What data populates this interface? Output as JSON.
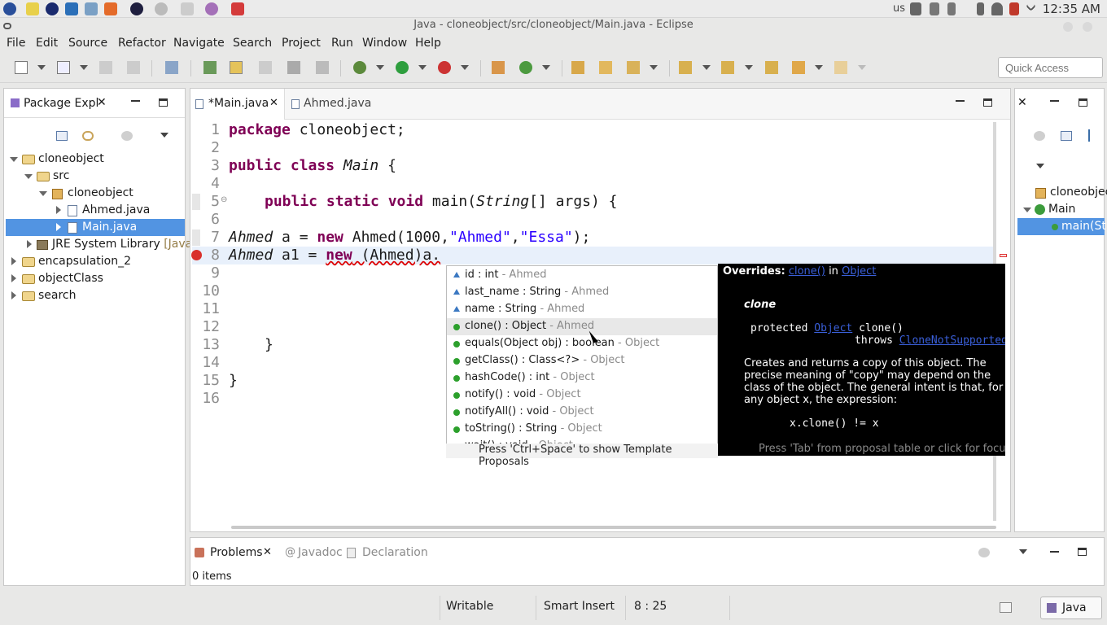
{
  "system": {
    "keyboard": "us",
    "clock": "12:35 AM"
  },
  "window": {
    "title": "Java - cloneobject/src/cloneobject/Main.java - Eclipse"
  },
  "menu": [
    "File",
    "Edit",
    "Source",
    "Refactor",
    "Navigate",
    "Search",
    "Project",
    "Run",
    "Window",
    "Help"
  ],
  "quick_access": {
    "placeholder": "Quick Access"
  },
  "package_explorer": {
    "tab": "Package Expl",
    "tree": [
      {
        "label": "cloneobject",
        "level": 0
      },
      {
        "label": "src",
        "level": 1
      },
      {
        "label": "cloneobject",
        "level": 2
      },
      {
        "label": "Ahmed.java",
        "level": 3
      },
      {
        "label": "Main.java",
        "level": 3
      },
      {
        "label": "JRE System Library",
        "suffix": "[JavaS",
        "level": 1
      },
      {
        "label": "encapsulation_2",
        "level": 0
      },
      {
        "label": "objectClass",
        "level": 0
      },
      {
        "label": "search",
        "level": 0
      }
    ]
  },
  "editor": {
    "tabs": [
      "*Main.java",
      "Ahmed.java"
    ],
    "lines": [
      "1",
      "2",
      "3",
      "4",
      "5",
      "6",
      "7",
      "8",
      "9",
      "10",
      "11",
      "12",
      "13",
      "14",
      "15",
      "16"
    ],
    "code": {
      "l1_kw": "package",
      "l1_rest": " cloneobject;",
      "l3_kw": "public class",
      "l3_name": "Main",
      "l3_rest": " {",
      "l5_kw": "public static void",
      "l5_m": " main(",
      "l5_t": "String",
      "l5_rest": "[] args) {",
      "l7_t": "Ahmed",
      "l7_v": " a = ",
      "l7_kw": "new",
      "l7_c": " Ahmed(1000,",
      "l7_s1": "\"Ahmed\"",
      "l7_comma": ",",
      "l7_s2": "\"Essa\"",
      "l7_end": ");",
      "l8_t": "Ahmed",
      "l8_v": " a1 = ",
      "l8_kw": "new",
      "l8_c": " (Ahmed)a.",
      "l13": "}",
      "l15": "}"
    }
  },
  "proposals": {
    "items": [
      {
        "name": "id : int",
        "qual": " - Ahmed",
        "icon": "field"
      },
      {
        "name": "last_name : String",
        "qual": " - Ahmed",
        "icon": "field"
      },
      {
        "name": "name : String",
        "qual": " - Ahmed",
        "icon": "field"
      },
      {
        "name": "clone() : Object",
        "qual": " - Ahmed",
        "icon": "method"
      },
      {
        "name": "equals(Object obj) : boolean",
        "qual": " - Object",
        "icon": "method"
      },
      {
        "name": "getClass() : Class<?>",
        "qual": " - Object",
        "icon": "method"
      },
      {
        "name": "hashCode() : int",
        "qual": " - Object",
        "icon": "method"
      },
      {
        "name": "notify() : void",
        "qual": " - Object",
        "icon": "method"
      },
      {
        "name": "notifyAll() : void",
        "qual": " - Object",
        "icon": "method"
      },
      {
        "name": "toString() : String",
        "qual": " - Object",
        "icon": "method"
      },
      {
        "name": "wait() : void",
        "qual": " - Object",
        "icon": "method"
      }
    ],
    "footer": "Press 'Ctrl+Space' to show Template Proposals"
  },
  "javadoc": {
    "overrides": "Overrides:",
    "clone_link": "clone()",
    "in": "in",
    "object_link": "Object",
    "heading": "clone",
    "sig_prefix": "protected",
    "sig_type": "Object",
    "sig_method": "clone()",
    "throws": "throws",
    "exc": "CloneNotSupportedException",
    "desc": "Creates and returns a copy of this object. The precise meaning of \"copy\" may depend on the class of the object. The general intent is that, for any object x, the expression:",
    "expr": "x.clone() != x",
    "focus_hint": "Press 'Tab' from proposal table or click for focus"
  },
  "outline": {
    "items": [
      "cloneobject",
      "Main",
      "main(St"
    ]
  },
  "bottom": {
    "tabs": [
      "Problems",
      "Javadoc",
      "Declaration"
    ],
    "items": "0 items"
  },
  "status": {
    "writable": "Writable",
    "insert": "Smart Insert",
    "position": "8 : 25",
    "perspective": "Java"
  }
}
